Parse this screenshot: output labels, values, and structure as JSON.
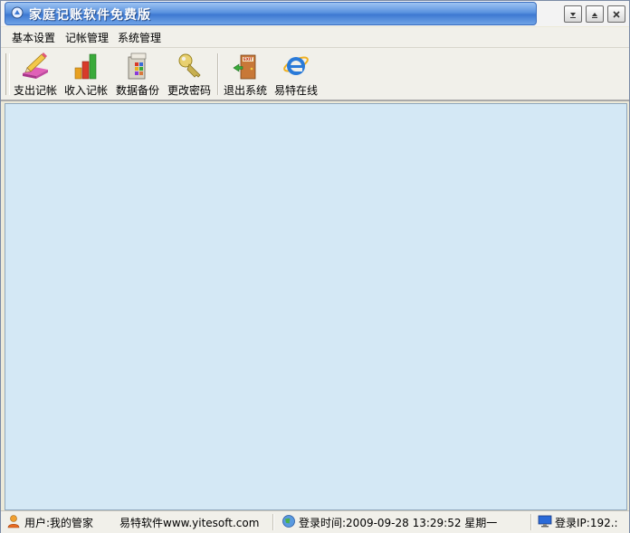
{
  "window": {
    "title": "家庭记账软件免费版"
  },
  "menu": [
    "基本设置",
    "记帐管理",
    "系统管理"
  ],
  "toolbar": [
    {
      "label": "支出记帐",
      "icon": "pencil-eraser-icon"
    },
    {
      "label": "收入记帐",
      "icon": "bar-chart-icon"
    },
    {
      "label": "数据备份",
      "icon": "database-backup-icon"
    },
    {
      "label": "更改密码",
      "icon": "key-icon"
    },
    {
      "label": "退出系统",
      "icon": "exit-door-icon"
    },
    {
      "label": "易特在线",
      "icon": "internet-explorer-icon"
    }
  ],
  "status": {
    "user": "用户:我的管家",
    "website": "易特软件www.yitesoft.com",
    "login_time": "登录时间:2009-09-28 13:29:52 星期一",
    "login_ip": "登录IP:192.:"
  },
  "colors": {
    "workspace": "#d4e8f5",
    "titlebar": "#4a86d8",
    "chrome": "#f1f0ea"
  }
}
